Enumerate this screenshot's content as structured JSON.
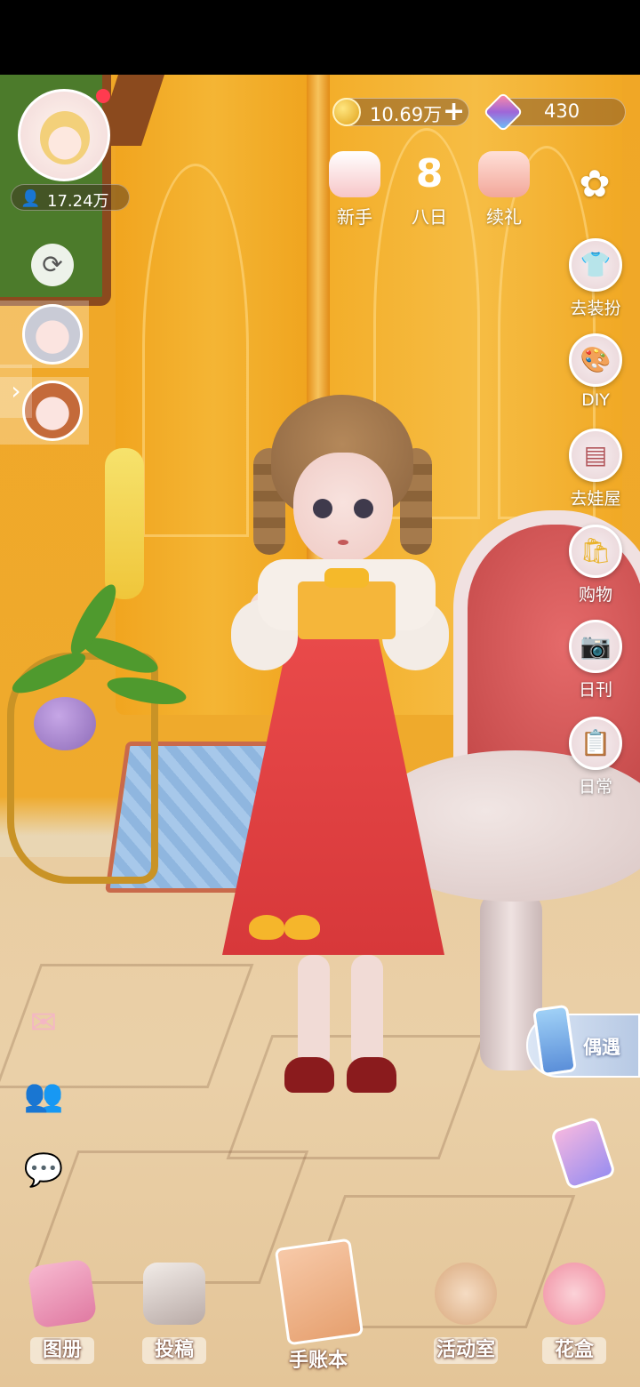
{
  "profile": {
    "fans_count": "17.24万"
  },
  "currency": {
    "coins": "10.69万",
    "gems": "430"
  },
  "top_buttons": [
    {
      "label": "新手",
      "icon": "newbie-cake-icon"
    },
    {
      "label": "八日",
      "icon": "eight-day-icon"
    },
    {
      "label": "续礼",
      "icon": "gift-tv-icon"
    }
  ],
  "right_menu": [
    {
      "label": "去装扮",
      "icon": "dress-up-shirt-icon"
    },
    {
      "label": "DIY",
      "icon": "palette-icon"
    },
    {
      "label": "去娃屋",
      "icon": "wardrobe-icon"
    },
    {
      "label": "购物",
      "icon": "shopping-bag-icon"
    },
    {
      "label": "日刊",
      "icon": "camera-icon"
    },
    {
      "label": "日常",
      "icon": "clipboard-icon"
    }
  ],
  "left_tools": [
    {
      "icon": "mail-icon"
    },
    {
      "icon": "friends-icon"
    },
    {
      "icon": "chat-icon"
    }
  ],
  "encounter": {
    "label": "偶遇"
  },
  "bottom_nav": [
    {
      "label": "图册",
      "icon": "album-icon"
    },
    {
      "label": "投稿",
      "icon": "film-clapper-icon"
    },
    {
      "label": "手账本",
      "icon": "journal-icon"
    },
    {
      "label": "活动室",
      "icon": "teddy-bear-icon"
    },
    {
      "label": "花盒",
      "icon": "flower-box-icon"
    }
  ],
  "colors": {
    "wall": "#f0a726",
    "accent_red": "#e94a4a",
    "badge": "#ff3b4f"
  }
}
